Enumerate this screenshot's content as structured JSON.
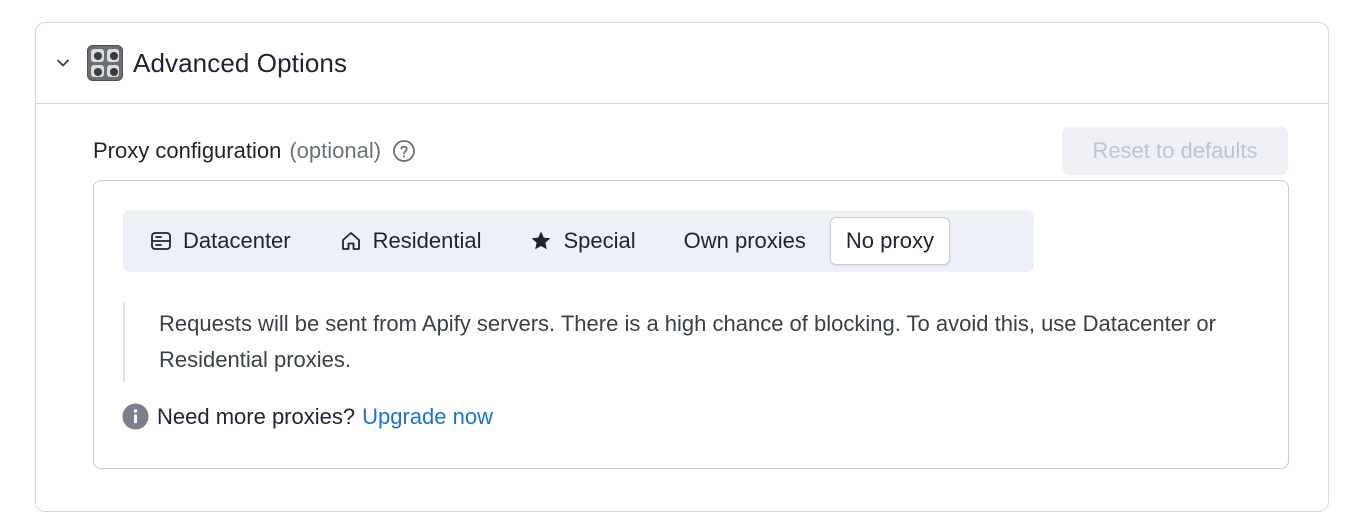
{
  "section": {
    "title": "Advanced Options",
    "icon": "control-knobs-icon"
  },
  "field": {
    "label": "Proxy configuration",
    "optional": "(optional)",
    "reset_label": "Reset to defaults"
  },
  "tabs": [
    {
      "label": "Datacenter",
      "icon": "server-icon",
      "active": false
    },
    {
      "label": "Residential",
      "icon": "home-icon",
      "active": false
    },
    {
      "label": "Special",
      "icon": "star-icon",
      "active": false
    },
    {
      "label": "Own proxies",
      "icon": "",
      "active": false
    },
    {
      "label": "No proxy",
      "icon": "",
      "active": true
    }
  ],
  "description": "Requests will be sent from Apify servers. There is a high chance of blocking. To avoid this, use Datacenter or Residential proxies.",
  "upgrade": {
    "text": "Need more proxies?",
    "link": "Upgrade now"
  },
  "colors": {
    "accent_link": "#1a73d9",
    "border": "#d6d9e2",
    "tab_bar_bg": "#eef0f7"
  }
}
